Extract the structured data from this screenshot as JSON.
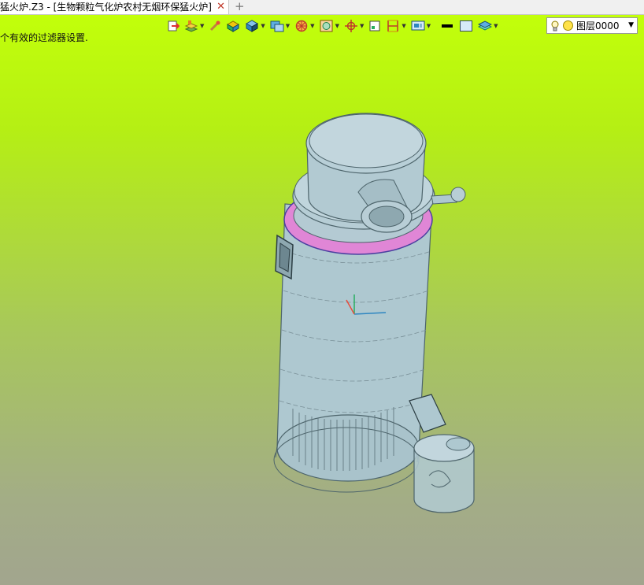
{
  "tab": {
    "title": "猛火炉.Z3 - [生物颗粒气化炉农村无烟环保猛火炉]",
    "close": "✕",
    "new_tab": "+"
  },
  "status": {
    "message": "个有效的过滤器设置."
  },
  "toolbar": {
    "buttons": [
      {
        "icon": "exit-sketch-icon"
      },
      {
        "icon": "layer-stack-icon"
      },
      {
        "icon": "brush-icon"
      },
      {
        "icon": "shaded-solid-icon"
      },
      {
        "icon": "cube-icon"
      },
      {
        "icon": "display-mode-icon"
      },
      {
        "icon": "render-style-icon"
      },
      {
        "icon": "texture-icon"
      },
      {
        "icon": "snap-icon"
      },
      {
        "icon": "frame-icon"
      },
      {
        "icon": "dimension-icon"
      },
      {
        "icon": "view-manager-icon"
      },
      {
        "icon": "line-color-icon"
      },
      {
        "icon": "face-color-icon"
      },
      {
        "icon": "layer-visibility-icon"
      }
    ]
  },
  "layer": {
    "name": "图层0000"
  },
  "colors": {
    "viewport_top": "#c2ff0a",
    "viewport_bottom": "#a2a58e",
    "model_body": "#aec8d0",
    "highlight_face": "#e086d6"
  }
}
